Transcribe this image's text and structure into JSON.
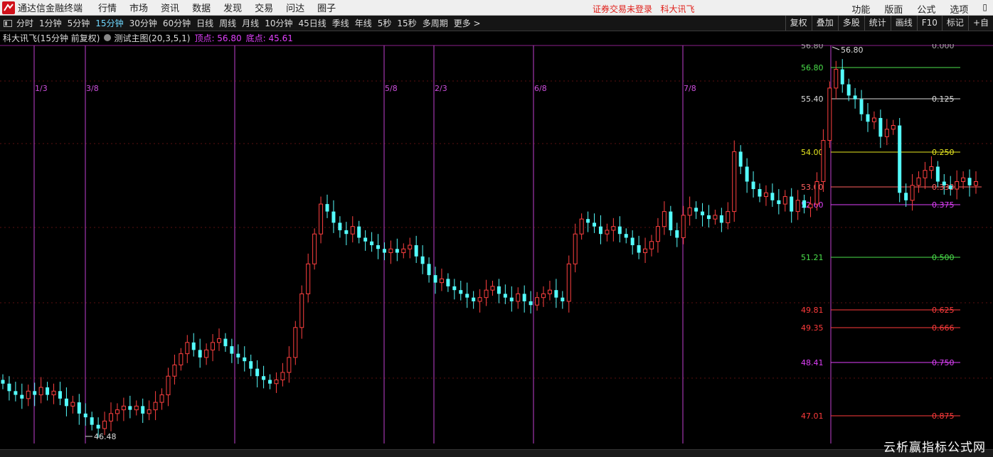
{
  "app": {
    "title": "通达信金融终端"
  },
  "menu": [
    "行情",
    "市场",
    "资讯",
    "数据",
    "发现",
    "交易",
    "问达",
    "圈子"
  ],
  "status": {
    "login": "证券交易未登录",
    "stock_name": "科大讯飞"
  },
  "right_menu": [
    "功能",
    "版面",
    "公式",
    "选项"
  ],
  "periods": [
    {
      "label": "分时",
      "active": false
    },
    {
      "label": "1分钟",
      "active": false
    },
    {
      "label": "5分钟",
      "active": false
    },
    {
      "label": "15分钟",
      "active": true
    },
    {
      "label": "30分钟",
      "active": false
    },
    {
      "label": "60分钟",
      "active": false
    },
    {
      "label": "日线",
      "active": false
    },
    {
      "label": "周线",
      "active": false
    },
    {
      "label": "月线",
      "active": false
    },
    {
      "label": "10分钟",
      "active": false
    },
    {
      "label": "45日线",
      "active": false
    },
    {
      "label": "季线",
      "active": false
    },
    {
      "label": "年线",
      "active": false
    },
    {
      "label": "5秒",
      "active": false
    },
    {
      "label": "15秒",
      "active": false
    },
    {
      "label": "多周期",
      "active": false
    },
    {
      "label": "更多 >",
      "active": false
    }
  ],
  "toolbar_right": [
    "复权",
    "叠加",
    "多股",
    "统计",
    "画线",
    "F10",
    "标记",
    "+自"
  ],
  "info": {
    "name": "科大讯飞(15分钟 前复权)",
    "indicator": "测试主图(20,3,5,1)",
    "peak": "顶点: 56.80",
    "trough": "底点: 45.61"
  },
  "chart_data": {
    "type": "candlestick",
    "y_range": [
      46.2,
      56.8
    ],
    "date_markers": [
      "1/3",
      "3/8",
      "5/8",
      "2/3",
      "6/8",
      "7/8"
    ],
    "annotations": {
      "high_label": "56.80",
      "low_label": "46.48"
    },
    "fib_levels": [
      {
        "price": "56.80",
        "ratio": "0.000",
        "color": "#aaaaaa"
      },
      {
        "price": "56.80",
        "ratio": "",
        "color": "#4be04b"
      },
      {
        "price": "55.40",
        "ratio": "0.125",
        "color": "#dddddd"
      },
      {
        "price": "54.00",
        "ratio": "0.250",
        "color": "#e8e820"
      },
      {
        "price": "53.00",
        "ratio": "0.333",
        "color": "#ff6060"
      },
      {
        "price": "52.60",
        "ratio": "0.375",
        "color": "#e040fb"
      },
      {
        "price": "51.21",
        "ratio": "0.500",
        "color": "#4be04b"
      },
      {
        "price": "49.81",
        "ratio": "0.625",
        "color": "#ff3b3b"
      },
      {
        "price": "49.35",
        "ratio": "0.666",
        "color": "#ff3b3b"
      },
      {
        "price": "48.41",
        "ratio": "0.750",
        "color": "#e040fb"
      },
      {
        "price": "47.01",
        "ratio": "0.875",
        "color": "#ff3b3b"
      }
    ],
    "closes": [
      47.8,
      47.6,
      47.5,
      47.4,
      47.6,
      47.5,
      47.7,
      47.5,
      47.6,
      47.4,
      47.2,
      47.3,
      47.0,
      46.9,
      46.7,
      46.6,
      46.8,
      47.0,
      47.1,
      47.2,
      47.1,
      47.2,
      47.0,
      47.1,
      47.3,
      47.5,
      48.0,
      48.3,
      48.6,
      48.9,
      48.7,
      48.5,
      48.7,
      48.9,
      49.0,
      48.8,
      48.6,
      48.5,
      48.4,
      48.2,
      48.0,
      47.9,
      47.8,
      47.9,
      48.1,
      48.5,
      49.3,
      50.2,
      51.0,
      51.8,
      52.6,
      52.4,
      52.1,
      51.9,
      51.8,
      52.0,
      51.7,
      51.6,
      51.5,
      51.4,
      51.3,
      51.4,
      51.3,
      51.4,
      51.5,
      51.2,
      51.0,
      50.7,
      50.5,
      50.6,
      50.4,
      50.3,
      50.2,
      50.1,
      50.0,
      50.1,
      50.3,
      50.4,
      50.2,
      50.1,
      50.0,
      50.2,
      50.0,
      49.9,
      50.1,
      50.2,
      50.3,
      50.1,
      50.0,
      51.0,
      51.8,
      52.2,
      52.1,
      52.0,
      51.8,
      51.9,
      52.0,
      51.8,
      51.7,
      51.5,
      51.3,
      51.4,
      51.6,
      52.0,
      52.4,
      51.9,
      51.7,
      52.3,
      52.5,
      52.4,
      52.3,
      52.2,
      52.3,
      52.1,
      52.4,
      54.0,
      53.6,
      53.2,
      53.0,
      52.8,
      52.9,
      52.7,
      52.6,
      52.8,
      52.4,
      52.7,
      52.5,
      52.6,
      53.2,
      54.3,
      55.7,
      56.2,
      55.8,
      55.5,
      55.4,
      55.0,
      54.8,
      54.9,
      54.4,
      54.6,
      54.7,
      52.9,
      52.7,
      53.1,
      53.3,
      53.5,
      53.6,
      53.2,
      53.1,
      53.0,
      53.2,
      53.3,
      53.1,
      53.2
    ]
  }
}
